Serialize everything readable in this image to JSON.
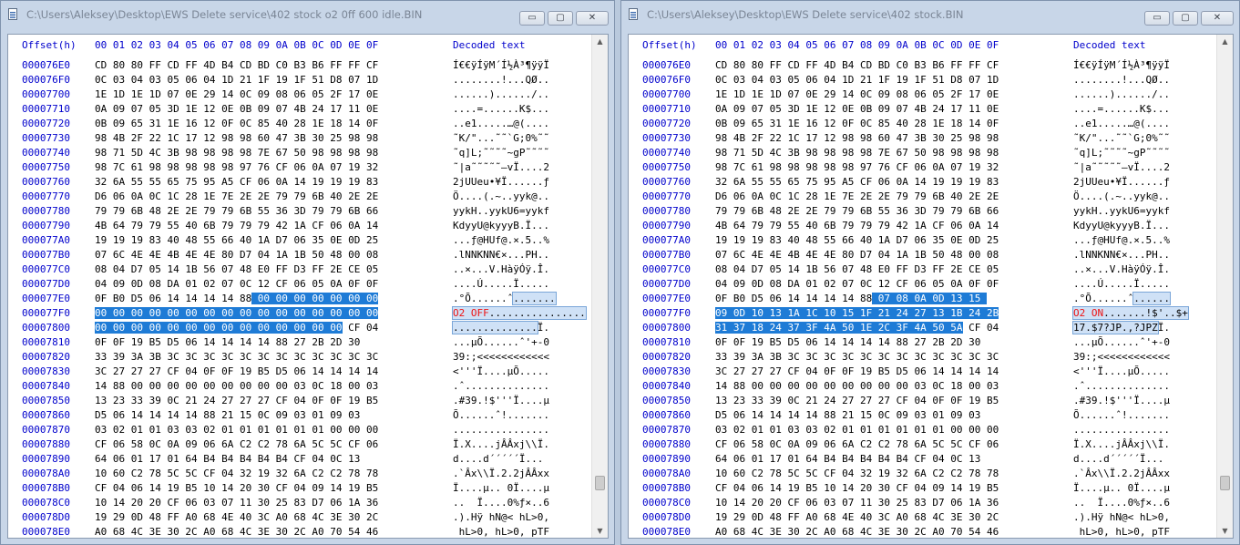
{
  "windows": [
    {
      "title": "C:\\Users\\Aleksey\\Desktop\\EWS Delete service\\402 stock o2 0ff 600 idle.BIN",
      "header": {
        "offset": "Offset(h)",
        "columns": "00 01 02 03 04 05 06 07 08 09 0A 0B 0C 0D 0E 0F",
        "decoded": "Decoded text"
      },
      "rows": [
        {
          "offset": "000076E0",
          "hex": "CD 80 80 FF CD FF 4D B4 CD BD C0 B3 B6 FF FF CF",
          "text": "Í€€ÿÍÿM´Í½À³¶ÿÿÏ"
        },
        {
          "offset": "000076F0",
          "hex": "0C 03 04 03 05 06 04 1D 21 1F 19 1F 51 D8 07 1D",
          "text": "........!...QØ.."
        },
        {
          "offset": "00007700",
          "hex": "1E 1D 1E 1D 07 0E 29 14 0C 09 08 06 05 2F 17 0E",
          "text": "......)....../.."
        },
        {
          "offset": "00007710",
          "hex": "0A 09 07 05 3D 1E 12 0E 0B 09 07 4B 24 17 11 0E",
          "text": "....=......K$..."
        },
        {
          "offset": "00007720",
          "hex": "0B 09 65 31 1E 16 12 0F 0C 85 40 28 1E 18 14 0F",
          "text": "..e1.....…@(...."
        },
        {
          "offset": "00007730",
          "hex": "98 4B 2F 22 1C 17 12 98 98 60 47 3B 30 25 98 98",
          "text": "˜K/\"...˜˜`G;0%˜˜"
        },
        {
          "offset": "00007740",
          "hex": "98 71 5D 4C 3B 98 98 98 98 7E 67 50 98 98 98 98",
          "text": "˜q]L;˜˜˜˜~gP˜˜˜˜"
        },
        {
          "offset": "00007750",
          "hex": "98 7C 61 98 98 98 98 98 97 76 CF 06 0A 07 19 32",
          "text": "˜|a˜˜˜˜˜—vÏ....2"
        },
        {
          "offset": "00007760",
          "hex": "32 6A 55 55 65 75 95 A5 CF 06 0A 14 19 19 19 83",
          "text": "2jUUeu•¥Ï......ƒ"
        },
        {
          "offset": "00007770",
          "hex": "D6 06 0A 0C 1C 28 1E 7E 2E 2E 79 79 6B 40 2E 2E",
          "text": "Ö....(.~..yyk@.."
        },
        {
          "offset": "00007780",
          "hex": "79 79 6B 48 2E 2E 79 79 6B 55 36 3D 79 79 6B 66",
          "text": "yykH..yykU6=yykf"
        },
        {
          "offset": "00007790",
          "hex": "4B 64 79 79 55 40 6B 79 79 79 42 1A CF 06 0A 14",
          "text": "KdyyU@kyyyB.Ï..."
        },
        {
          "offset": "000077A0",
          "hex": "19 19 19 83 40 48 55 66 40 1A D7 06 35 0E 0D 25",
          "text": "...ƒ@HUf@.×.5..%"
        },
        {
          "offset": "000077B0",
          "hex": "07 6C 4E 4E 4B 4E 4E 80 D7 04 1A 1B 50 48 00 08",
          "text": ".lNNKNN€×...PH.."
        },
        {
          "offset": "000077C0",
          "hex": "08 04 D7 05 14 1B 56 07 48 E0 FF D3 FF 2E CE 05",
          "text": "..×...V.HàÿÓÿ.Î."
        },
        {
          "offset": "000077D0",
          "hex": "04 09 0D 08 DA 01 02 07 0C 12 CF 06 05 0A 0F 0F",
          "text": "....Ú.....Ï....."
        },
        {
          "offset": "000077E0",
          "hex": "0F B0 D5 06 14 14 14 14 88",
          "hexSel": " 00 00 00 00 00 00 00",
          "text": ".°Õ......ˆ",
          "textSel": "......."
        },
        {
          "offset": "000077F0",
          "hexSel": "00 00 00 00 00 00 00 00 00 00 00 00 00 00 00 00",
          "textSel": "................",
          "mark": "O2 OFF"
        },
        {
          "offset": "00007800",
          "hexSel": "00 00 00 00 00 00 00 00 00 00 00 00 00 00",
          "hex": " CF 04",
          "textSel": "..............",
          "text": "Ï."
        },
        {
          "offset": "00007810",
          "hex": "0F 0F 19 B5 D5 06 14 14 14 14 88 27 2B 2D 30 ",
          "text": "...µÕ......ˆ'+-0"
        },
        {
          "offset": "00007820",
          "hex": "33 39 3A 3B 3C 3C 3C 3C 3C 3C 3C 3C 3C 3C 3C 3C",
          "text": "39:;<<<<<<<<<<<<"
        },
        {
          "offset": "00007830",
          "hex": "3C 27 27 27 CF 04 0F 0F 19 B5 D5 06 14 14 14 14",
          "text": "<'''Ï....µÕ....."
        },
        {
          "offset": "00007840",
          "hex": "14 88 00 00 00 00 00 00 00 00 00 03 0C 18 00 03",
          "text": ".ˆ.............."
        },
        {
          "offset": "00007850",
          "hex": "13 23 33 39 0C 21 24 27 27 27 CF 04 0F 0F 19 B5",
          "text": ".#39.!$'''Ï....µ"
        },
        {
          "offset": "00007860",
          "hex": "D5 06 14 14 14 14 88 21 15 0C 09 03 01 09 03 ",
          "text": "Õ......ˆ!......."
        },
        {
          "offset": "00007870",
          "hex": "03 02 01 01 03 03 02 01 01 01 01 01 01 00 00 00",
          "text": "................"
        },
        {
          "offset": "00007880",
          "hex": "CF 06 58 0C 0A 09 06 6A C2 C2 78 6A 5C 5C CF 06",
          "text": "Ï.X....jÂÂxj\\\\Ï."
        },
        {
          "offset": "00007890",
          "hex": "64 06 01 17 01 64 B4 B4 B4 B4 B4 CF 04 0C 13",
          "text": "d....d´´´´´Ï..."
        },
        {
          "offset": "000078A0",
          "hex": "10 60 C2 78 5C 5C CF 04 32 19 32 6A C2 C2 78 78",
          "text": ".`Âx\\\\Ï.2.2jÂÂxx"
        },
        {
          "offset": "000078B0",
          "hex": "CF 04 06 14 19 B5 10 14 20 30 CF 04 09 14 19 B5",
          "text": "Ï....µ.. 0Ï....µ"
        },
        {
          "offset": "000078C0",
          "hex": "10 14 20 20 CF 06 03 07 11 30 25 83 D7 06 1A 36",
          "text": "..  Ï....0%ƒ×..6"
        },
        {
          "offset": "000078D0",
          "hex": "19 29 0D 48 FF A0 68 4E 40 3C A0 68 4C 3E 30 2C",
          "text": ".).Hÿ hN@< hL>0,"
        },
        {
          "offset": "000078E0",
          "hex": "A0 68 4C 3E 30 2C A0 68 4C 3E 30 2C A0 70 54 46",
          "text": " hL>0, hL>0, pTF"
        }
      ]
    },
    {
      "title": "C:\\Users\\Aleksey\\Desktop\\EWS Delete service\\402 stock.BIN",
      "header": {
        "offset": "Offset(h)",
        "columns": "00 01 02 03 04 05 06 07 08 09 0A 0B 0C 0D 0E 0F",
        "decoded": "Decoded text"
      },
      "rows": [
        {
          "offset": "000076E0",
          "hex": "CD 80 80 FF CD FF 4D B4 CD BD C0 B3 B6 FF FF CF",
          "text": "Í€€ÿÍÿM´Í½À³¶ÿÿÏ"
        },
        {
          "offset": "000076F0",
          "hex": "0C 03 04 03 05 06 04 1D 21 1F 19 1F 51 D8 07 1D",
          "text": "........!...QØ.."
        },
        {
          "offset": "00007700",
          "hex": "1E 1D 1E 1D 07 0E 29 14 0C 09 08 06 05 2F 17 0E",
          "text": "......)....../.."
        },
        {
          "offset": "00007710",
          "hex": "0A 09 07 05 3D 1E 12 0E 0B 09 07 4B 24 17 11 0E",
          "text": "....=......K$..."
        },
        {
          "offset": "00007720",
          "hex": "0B 09 65 31 1E 16 12 0F 0C 85 40 28 1E 18 14 0F",
          "text": "..e1.....…@(...."
        },
        {
          "offset": "00007730",
          "hex": "98 4B 2F 22 1C 17 12 98 98 60 47 3B 30 25 98 98",
          "text": "˜K/\"...˜˜`G;0%˜˜"
        },
        {
          "offset": "00007740",
          "hex": "98 71 5D 4C 3B 98 98 98 98 7E 67 50 98 98 98 98",
          "text": "˜q]L;˜˜˜˜~gP˜˜˜˜"
        },
        {
          "offset": "00007750",
          "hex": "98 7C 61 98 98 98 98 98 97 76 CF 06 0A 07 19 32",
          "text": "˜|a˜˜˜˜˜—vÏ....2"
        },
        {
          "offset": "00007760",
          "hex": "32 6A 55 55 65 75 95 A5 CF 06 0A 14 19 19 19 83",
          "text": "2jUUeu•¥Ï......ƒ"
        },
        {
          "offset": "00007770",
          "hex": "D6 06 0A 0C 1C 28 1E 7E 2E 2E 79 79 6B 40 2E 2E",
          "text": "Ö....(.~..yyk@.."
        },
        {
          "offset": "00007780",
          "hex": "79 79 6B 48 2E 2E 79 79 6B 55 36 3D 79 79 6B 66",
          "text": "yykH..yykU6=yykf"
        },
        {
          "offset": "00007790",
          "hex": "4B 64 79 79 55 40 6B 79 79 79 42 1A CF 06 0A 14",
          "text": "KdyyU@kyyyB.Ï..."
        },
        {
          "offset": "000077A0",
          "hex": "19 19 19 83 40 48 55 66 40 1A D7 06 35 0E 0D 25",
          "text": "...ƒ@HUf@.×.5..%"
        },
        {
          "offset": "000077B0",
          "hex": "07 6C 4E 4E 4B 4E 4E 80 D7 04 1A 1B 50 48 00 08",
          "text": ".lNNKNN€×...PH.."
        },
        {
          "offset": "000077C0",
          "hex": "08 04 D7 05 14 1B 56 07 48 E0 FF D3 FF 2E CE 05",
          "text": "..×...V.HàÿÓÿ.Î."
        },
        {
          "offset": "000077D0",
          "hex": "04 09 0D 08 DA 01 02 07 0C 12 CF 06 05 0A 0F 0F",
          "text": "....Ú.....Ï....."
        },
        {
          "offset": "000077E0",
          "hex": "0F B0 D5 06 14 14 14 14 88",
          "hexSel": " 07 08 0A 0D 13 15 ",
          "text": ".°Õ......ˆ",
          "textSel": "......"
        },
        {
          "offset": "000077F0",
          "hexSel": "09 0D 10 13 1A 1C 10 15 1F 21 24 27 13 1B 24 2B",
          "textSel": ".......!$'..$+",
          "mark": "O2 ON"
        },
        {
          "offset": "00007800",
          "hexSel": "31 37 18 24 37 3F 4A 50 1E 2C 3F 4A 50 5A",
          "hex": " CF 04",
          "textSel": "17.$7?JP.,?JPZ",
          "text": "Ï."
        },
        {
          "offset": "00007810",
          "hex": "0F 0F 19 B5 D5 06 14 14 14 14 88 27 2B 2D 30 ",
          "text": "...µÕ......ˆ'+-0"
        },
        {
          "offset": "00007820",
          "hex": "33 39 3A 3B 3C 3C 3C 3C 3C 3C 3C 3C 3C 3C 3C 3C",
          "text": "39:;<<<<<<<<<<<<"
        },
        {
          "offset": "00007830",
          "hex": "3C 27 27 27 CF 04 0F 0F 19 B5 D5 06 14 14 14 14",
          "text": "<'''Ï....µÕ....."
        },
        {
          "offset": "00007840",
          "hex": "14 88 00 00 00 00 00 00 00 00 00 03 0C 18 00 03",
          "text": ".ˆ.............."
        },
        {
          "offset": "00007850",
          "hex": "13 23 33 39 0C 21 24 27 27 27 CF 04 0F 0F 19 B5",
          "text": ".#39.!$'''Ï....µ"
        },
        {
          "offset": "00007860",
          "hex": "D5 06 14 14 14 14 88 21 15 0C 09 03 01 09 03 ",
          "text": "Õ......ˆ!......."
        },
        {
          "offset": "00007870",
          "hex": "03 02 01 01 03 03 02 01 01 01 01 01 01 00 00 00",
          "text": "................"
        },
        {
          "offset": "00007880",
          "hex": "CF 06 58 0C 0A 09 06 6A C2 C2 78 6A 5C 5C CF 06",
          "text": "Ï.X....jÂÂxj\\\\Ï."
        },
        {
          "offset": "00007890",
          "hex": "64 06 01 17 01 64 B4 B4 B4 B4 B4 CF 04 0C 13",
          "text": "d....d´´´´´Ï..."
        },
        {
          "offset": "000078A0",
          "hex": "10 60 C2 78 5C 5C CF 04 32 19 32 6A C2 C2 78 78",
          "text": ".`Âx\\\\Ï.2.2jÂÂxx"
        },
        {
          "offset": "000078B0",
          "hex": "CF 04 06 14 19 B5 10 14 20 30 CF 04 09 14 19 B5",
          "text": "Ï....µ.. 0Ï....µ"
        },
        {
          "offset": "000078C0",
          "hex": "10 14 20 20 CF 06 03 07 11 30 25 83 D7 06 1A 36",
          "text": "..  Ï....0%ƒ×..6"
        },
        {
          "offset": "000078D0",
          "hex": "19 29 0D 48 FF A0 68 4E 40 3C A0 68 4C 3E 30 2C",
          "text": ".).Hÿ hN@< hL>0,"
        },
        {
          "offset": "000078E0",
          "hex": "A0 68 4C 3E 30 2C A0 68 4C 3E 30 2C A0 70 54 46",
          "text": " hL>0, hL>0, pTF"
        }
      ]
    }
  ],
  "controls": {
    "minimize": "▭",
    "maximize": "▢",
    "close": "✕"
  },
  "icons": {
    "app": "document-icon",
    "scroll_up": "▲",
    "scroll_down": "▼"
  },
  "colors": {
    "offset": "#0000cc",
    "selection": "#1e7bd6",
    "annotation": "#ee1111"
  }
}
